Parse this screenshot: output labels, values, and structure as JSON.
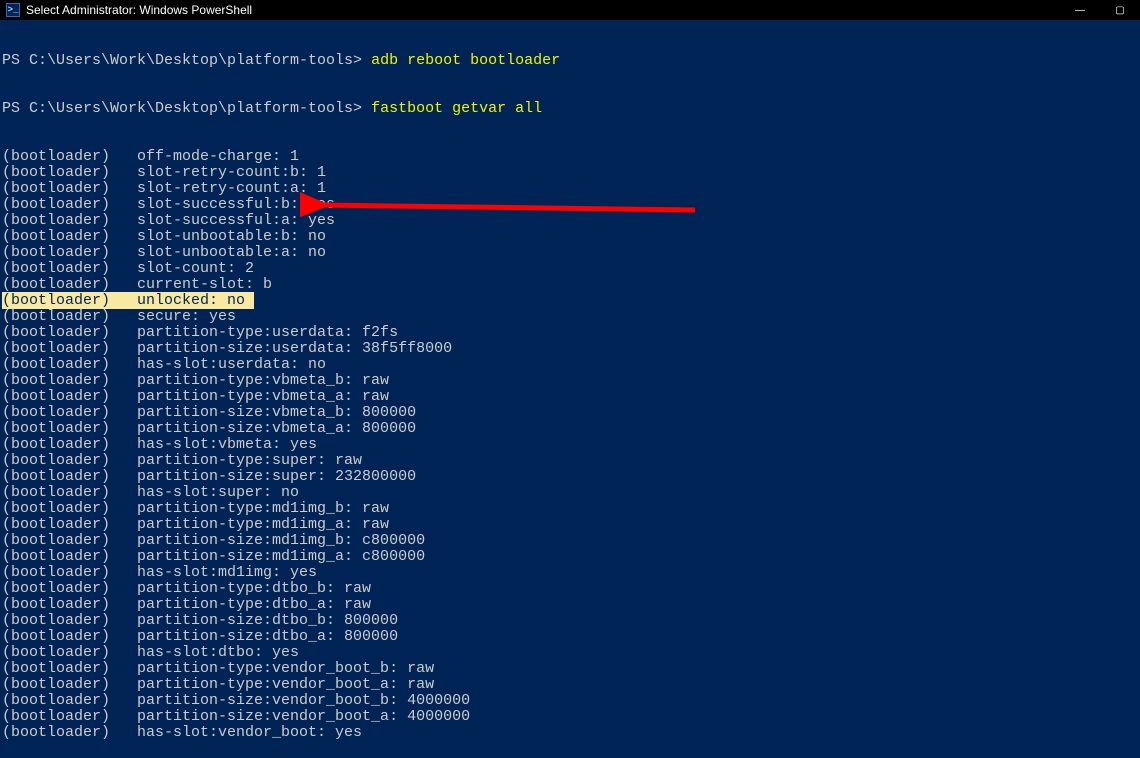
{
  "titlebar": {
    "icon_glyph": ">_",
    "title": "Select Administrator: Windows PowerShell",
    "min": "—",
    "max": "▢"
  },
  "terminal": {
    "prompt": "PS C:\\Users\\Work\\Desktop\\platform-tools> ",
    "cmd1": "adb reboot bootloader",
    "cmd2": "fastboot getvar all",
    "highlight_index": 9,
    "lines": [
      "(bootloader)   off-mode-charge: 1",
      "(bootloader)   slot-retry-count:b: 1",
      "(bootloader)   slot-retry-count:a: 1",
      "(bootloader)   slot-successful:b: yes",
      "(bootloader)   slot-successful:a: yes",
      "(bootloader)   slot-unbootable:b: no",
      "(bootloader)   slot-unbootable:a: no",
      "(bootloader)   slot-count: 2",
      "(bootloader)   current-slot: b",
      "(bootloader)   unlocked: no ",
      "(bootloader)   secure: yes",
      "(bootloader)   partition-type:userdata: f2fs",
      "(bootloader)   partition-size:userdata: 38f5ff8000",
      "(bootloader)   has-slot:userdata: no",
      "(bootloader)   partition-type:vbmeta_b: raw",
      "(bootloader)   partition-type:vbmeta_a: raw",
      "(bootloader)   partition-size:vbmeta_b: 800000",
      "(bootloader)   partition-size:vbmeta_a: 800000",
      "(bootloader)   has-slot:vbmeta: yes",
      "(bootloader)   partition-type:super: raw",
      "(bootloader)   partition-size:super: 232800000",
      "(bootloader)   has-slot:super: no",
      "(bootloader)   partition-type:md1img_b: raw",
      "(bootloader)   partition-type:md1img_a: raw",
      "(bootloader)   partition-size:md1img_b: c800000",
      "(bootloader)   partition-size:md1img_a: c800000",
      "(bootloader)   has-slot:md1img: yes",
      "(bootloader)   partition-type:dtbo_b: raw",
      "(bootloader)   partition-type:dtbo_a: raw",
      "(bootloader)   partition-size:dtbo_b: 800000",
      "(bootloader)   partition-size:dtbo_a: 800000",
      "(bootloader)   has-slot:dtbo: yes",
      "(bootloader)   partition-type:vendor_boot_b: raw",
      "(bootloader)   partition-type:vendor_boot_a: raw",
      "(bootloader)   partition-size:vendor_boot_b: 4000000",
      "(bootloader)   partition-size:vendor_boot_a: 4000000",
      "(bootloader)   has-slot:vendor_boot: yes"
    ]
  },
  "annotation": {
    "arrow_color": "#ff0000"
  }
}
